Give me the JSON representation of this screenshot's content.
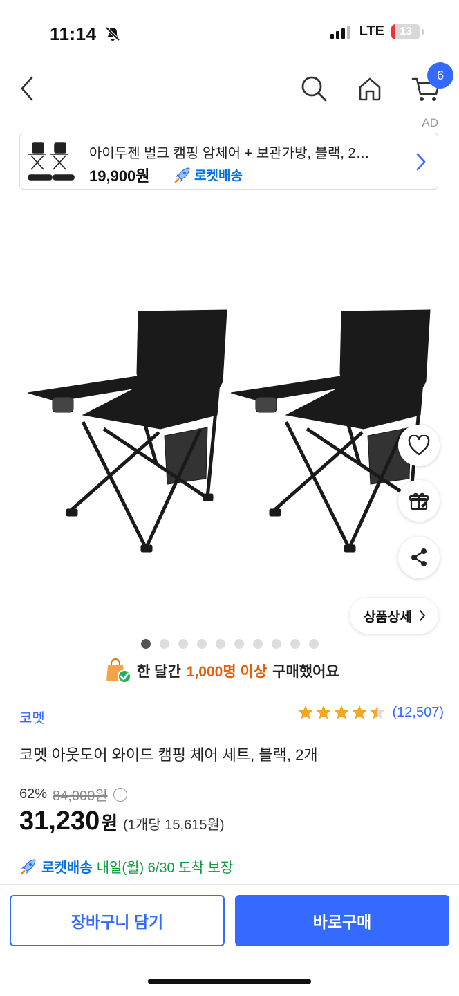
{
  "status_bar": {
    "time": "11:14",
    "network": "LTE",
    "battery": "13"
  },
  "nav": {
    "cart_count": "6"
  },
  "ad": {
    "label": "AD",
    "title": "아이두젠 벌크 캠핑 암체어 + 보관가방, 블랙, 2…",
    "price": "19,900원",
    "rocket_label": "로켓배송"
  },
  "gallery": {
    "total": 10,
    "active": 0
  },
  "detail_button": "상품상세",
  "purchase_note": {
    "pre": "한 달간",
    "highlight": "1,000명 이상",
    "post": "구매했어요"
  },
  "product": {
    "brand": "코멧",
    "rating": 4.5,
    "review_count": "(12,507)",
    "title": "코멧 아웃도어 와이드 캠핑 체어 세트, 블랙, 2개",
    "discount": "62%",
    "original_price": "84,000원",
    "price": "31,230",
    "currency": "원",
    "unit_price": "(1개당 15,615원)"
  },
  "delivery": {
    "rocket": "로켓배송",
    "text": "내일(월) 6/30 도착 보장"
  },
  "buttons": {
    "cart": "장바구니 담기",
    "buy": "바로구매"
  },
  "colors": {
    "accent": "#346aff",
    "rocket": "#0073e9",
    "highlight": "#e85d04",
    "delivery_green": "#0a9b3a",
    "star": "#f5a623"
  }
}
